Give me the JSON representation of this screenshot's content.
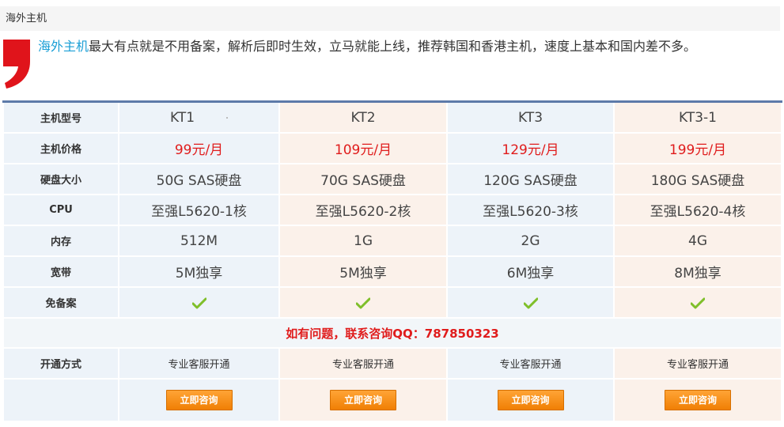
{
  "section": {
    "title": "海外主机"
  },
  "intro": {
    "highlight": "海外主机",
    "text": "最大有点就是不用备案，解析后即时生效，立马就能上线，推荐韩国和香港主机，速度上基本和国内差不多。"
  },
  "table": {
    "rows": [
      {
        "label": "主机型号",
        "cells": [
          "KT1",
          "KT2",
          "KT3",
          "KT3-1"
        ]
      },
      {
        "label": "主机价格",
        "cells": [
          "99元/月",
          "109元/月",
          "129元/月",
          "199元/月"
        ]
      },
      {
        "label": "硬盘大小",
        "cells": [
          "50G SAS硬盘",
          "70G SAS硬盘",
          "120G SAS硬盘",
          "180G SAS硬盘"
        ]
      },
      {
        "label": "CPU",
        "cells": [
          "至强L5620-1核",
          "至强L5620-2核",
          "至强L5620-3核",
          "至强L5620-4核"
        ]
      },
      {
        "label": "内存",
        "cells": [
          "512M",
          "1G",
          "2G",
          "4G"
        ]
      },
      {
        "label": "宽带",
        "cells": [
          "5M独享",
          "5M独享",
          "6M独享",
          "8M独享"
        ]
      },
      {
        "label": "免备案",
        "cells": [
          "check-icon",
          "check-icon",
          "check-icon",
          "check-icon"
        ]
      }
    ],
    "contact": "如有问题，联系咨询QQ：787850323",
    "activation": {
      "label": "开通方式",
      "cells": [
        "专业客服开通",
        "专业客服开通",
        "专业客服开通",
        "专业客服开通"
      ]
    },
    "button_label": "立即咨询"
  },
  "colors": {
    "accent_blue": "#1a9fd6",
    "price_red": "#e01c1c",
    "quote_red": "#e0141b",
    "check_green": "#7fbf2a",
    "button_orange": "#f59316",
    "header_border": "#5d7aa9"
  }
}
